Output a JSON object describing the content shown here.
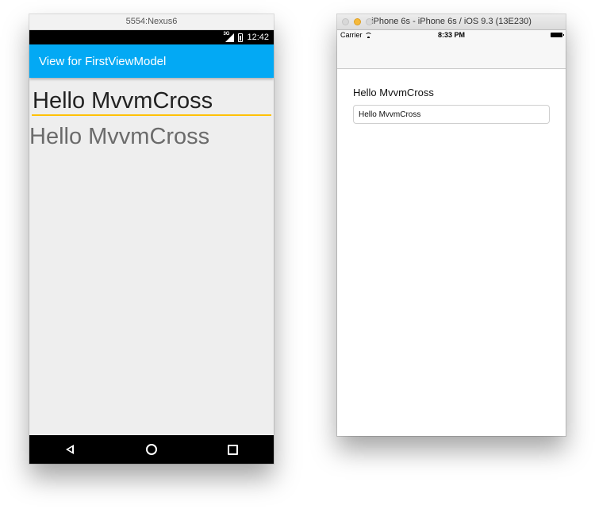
{
  "android": {
    "window_title": "5554:Nexus6",
    "status": {
      "network": "3G",
      "time": "12:42"
    },
    "app_bar_title": "View for FirstViewModel",
    "edit_text_value": "Hello MvvmCross",
    "label_text": "Hello MvvmCross",
    "accent_color": "#03a9f4",
    "underline_color": "#ffc107",
    "nav_icons": [
      "back-icon",
      "home-icon",
      "recents-icon"
    ]
  },
  "ios": {
    "window_title": "iPhone 6s - iPhone 6s / iOS 9.3 (13E230)",
    "status": {
      "carrier": "Carrier",
      "time": "8:33 PM"
    },
    "label_text": "Hello MvvmCross",
    "field_value": "Hello MvvmCross"
  }
}
